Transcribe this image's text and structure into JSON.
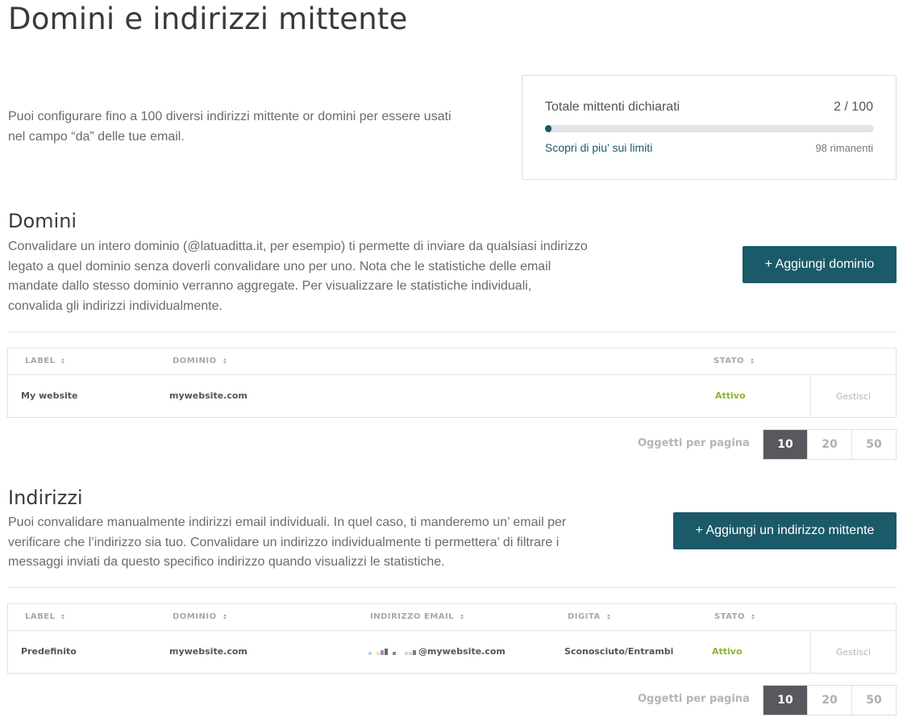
{
  "page": {
    "title": "Domini e indirizzi mittente"
  },
  "intro": {
    "text": "Puoi configurare fino a 100 diversi indirizzi mittente or domini per essere usati nel campo “da” delle tue email."
  },
  "limits": {
    "label": "Totale mittenti dichiarati",
    "count": "2 / 100",
    "used_fraction": 0.02,
    "link_label": "Scopri di piu’ sui limiti",
    "remaining": "98 rimanenti"
  },
  "domains": {
    "title": "Domini",
    "description": "Convalidare un intero dominio (@latuaditta.it, per esempio) ti permette di inviare da qualsiasi indirizzo legato a quel dominio senza doverli convalidare uno per uno. Nota che le statistiche delle email mandate dallo stesso dominio verranno aggregate. Per visualizzare le statistiche individuali, convalida gli indirizzi individualmente.",
    "add_button": "+ Aggiungi dominio",
    "columns": {
      "label": "LABEL",
      "domain": "DOMINIO",
      "status": "STATO"
    },
    "rows": [
      {
        "label": "My website",
        "domain": "mywebsite.com",
        "status": "Attivo",
        "action": "Gestisci"
      }
    ],
    "pagination": {
      "label": "Oggetti per pagina",
      "options": [
        "10",
        "20",
        "50"
      ],
      "selected": "10"
    }
  },
  "addresses": {
    "title": "Indirizzi",
    "description": "Puoi convalidare manualmente indirizzi email individuali. In quel caso, ti manderemo un’ email per verificare che l’indirizzo sia tuo. Convalidare un indirizzo individualmente ti permettera’ di filtrare i messaggi inviati da questo specifico indirizzo quando visualizzi le statistiche.",
    "add_button": "+ Aggiungi un indirizzo mittente",
    "columns": {
      "label": "LABEL",
      "domain": "DOMINIO",
      "email": "INDIRIZZO EMAIL",
      "type": "DIGITA",
      "status": "STATO"
    },
    "rows": [
      {
        "label": "Predefinito",
        "domain": "mywebsite.com",
        "email_suffix": "@mywebsite.com",
        "type": "Sconosciuto/Entrambi",
        "status": "Attivo",
        "action": "Gestisci"
      }
    ],
    "pagination": {
      "label": "Oggetti per pagina",
      "options": [
        "10",
        "20",
        "50"
      ],
      "selected": "10"
    }
  },
  "colors": {
    "primary": "#1b5a69",
    "active_status": "#8ab430",
    "pager_active": "#58585e"
  }
}
